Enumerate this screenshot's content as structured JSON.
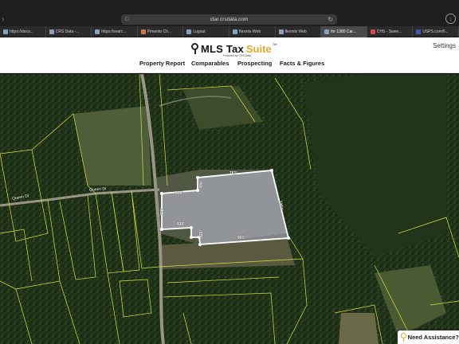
{
  "browser": {
    "url": "ctar.crsdata.com",
    "tabs": [
      {
        "label": "https://docs...",
        "active": false
      },
      {
        "label": "CRS Data -...",
        "active": false
      },
      {
        "label": "https://searc...",
        "active": false
      },
      {
        "label": "Pimento Ch...",
        "active": false
      },
      {
        "label": "Logout",
        "active": false
      },
      {
        "label": "flexmls Web",
        "active": false
      },
      {
        "label": "flexmls Web",
        "active": false
      },
      {
        "label": "for 1380 Car...",
        "active": true
      },
      {
        "label": "CHS - Swee...",
        "active": false
      },
      {
        "label": "USPS.com®...",
        "active": false
      }
    ]
  },
  "app": {
    "logo_main": "MLS Tax",
    "logo_accent": "Suite",
    "logo_tm": "TM",
    "logo_sub": "Powered by CRS Data",
    "settings_label": "Settings",
    "nav": [
      "Property Report",
      "Comparables",
      "Prospecting",
      "Facts & Figures"
    ]
  },
  "map": {
    "measurements": [
      "761'",
      "300'",
      "380'",
      "1254'",
      "380'",
      "430'",
      "329'",
      "901'"
    ],
    "road_labels": [
      "Queen Dr",
      "Queen Dr"
    ],
    "parcel_color": "#d8e23a",
    "selection_color": "#ffffff"
  },
  "assist": {
    "label": "Need Assistance?"
  }
}
